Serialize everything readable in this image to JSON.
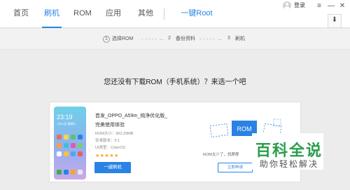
{
  "nav": {
    "home": "首页",
    "flash": "刷机",
    "rom": "ROM",
    "apps": "应用",
    "other": "其他",
    "root": "一键Root"
  },
  "window": {
    "login": "登录",
    "menu_glyph": "≡",
    "minimize_glyph": "—",
    "close_glyph": "✕",
    "download_glyph": "⬇"
  },
  "steps": [
    {
      "num": "1",
      "label": "选择ROM"
    },
    {
      "num": "2",
      "label": "备份资料"
    },
    {
      "num": "3",
      "label": "刷机"
    }
  ],
  "prompt": "您还没有下载ROM（手机系统）？来选一个吧",
  "card": {
    "phone_time": "23:19",
    "phone_date": "1月10日 星期二",
    "title_line1": "首发_OPPO_A59m_纯净优化版_",
    "title_line2": "完美使用体验",
    "size": "ROM大小：962.29MB",
    "android": "安卓版本：5.1",
    "ui": "UI类型：ColorOS",
    "stars": "★★★★★",
    "flash_button": "一键刷机",
    "rom_badge": "ROM",
    "rom_text": "ROM太少了，找摩摩",
    "request_button": "立即申请"
  },
  "watermark": {
    "big": "百科全说",
    "small": "助你轻松解决"
  },
  "colors": {
    "accent": "#2a82e4",
    "star": "#f6a623",
    "watermark_green": "#2a9d4a"
  }
}
